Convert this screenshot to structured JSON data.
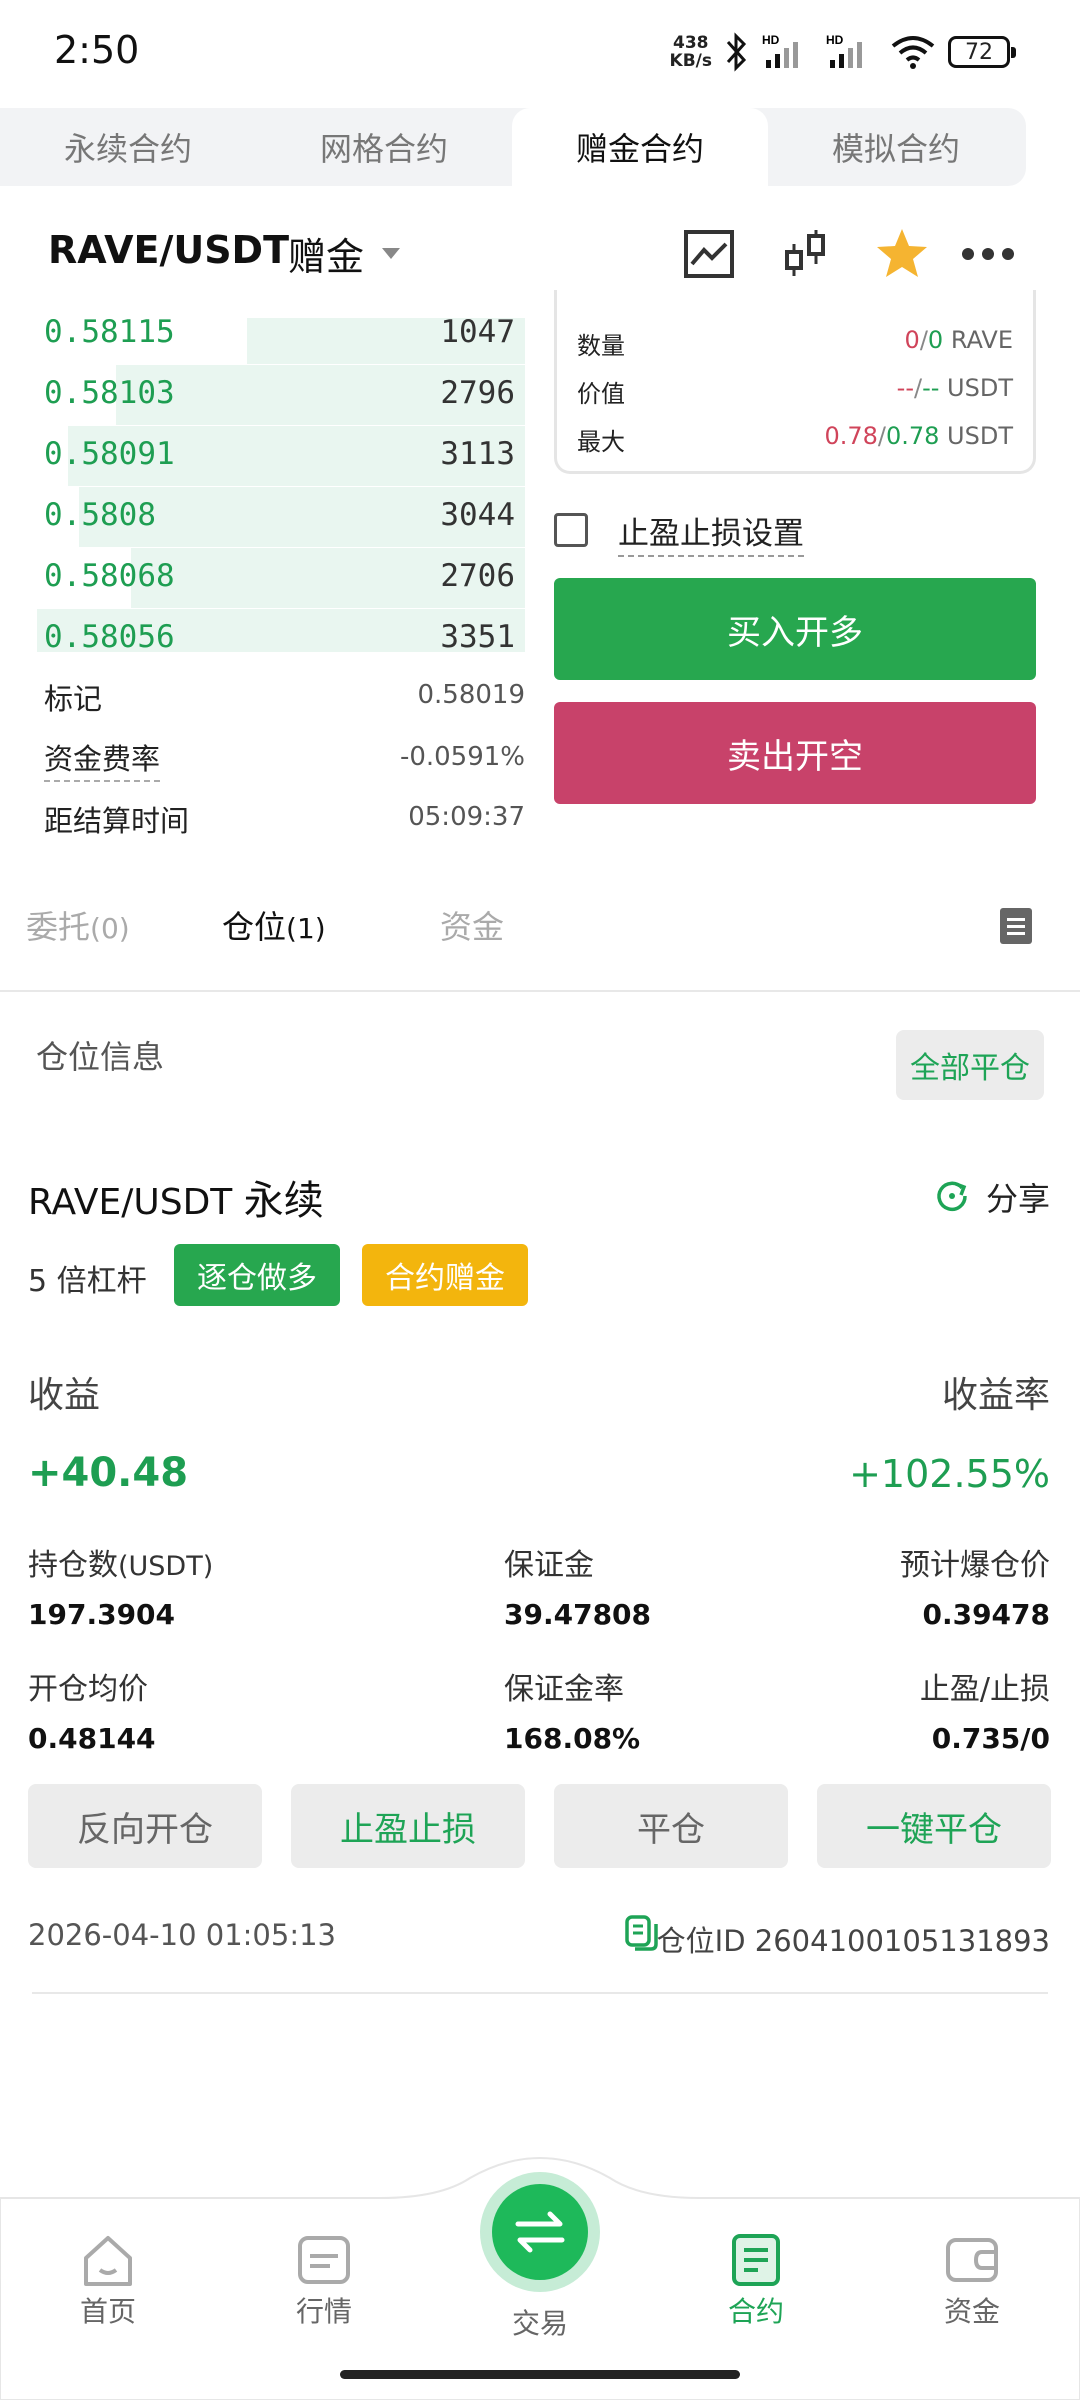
{
  "status_bar": {
    "time": "2:50",
    "net_speed_value": "438",
    "net_speed_unit": "KB/s",
    "battery": "72"
  },
  "tabs": [
    {
      "label": "永续合约",
      "active": false
    },
    {
      "label": "网格合约",
      "active": false
    },
    {
      "label": "赠金合约",
      "active": true
    },
    {
      "label": "模拟合约",
      "active": false
    }
  ],
  "header": {
    "pair": "RAVE/USDT",
    "type": "赠金"
  },
  "order_book": [
    {
      "price": "0.58115",
      "qty": "1047",
      "depth": 0.53
    },
    {
      "price": "0.58103",
      "qty": "2796",
      "depth": 0.78
    },
    {
      "price": "0.58091",
      "qty": "3113",
      "depth": 0.87
    },
    {
      "price": "0.5808",
      "qty": "3044",
      "depth": 0.85
    },
    {
      "price": "0.58068",
      "qty": "2706",
      "depth": 0.75
    },
    {
      "price": "0.58056",
      "qty": "3351",
      "depth": 0.93
    }
  ],
  "market_info": {
    "mark_label": "标记",
    "mark_value": "0.58019",
    "funding_label": "资金费率",
    "funding_value": "-0.0591%",
    "settle_label": "距结算时间",
    "settle_value": "05:09:37"
  },
  "order_card": {
    "qty_label": "数量",
    "qty_a": "0",
    "qty_b": "0",
    "qty_unit": "RAVE",
    "value_label": "价值",
    "value_a": "--",
    "value_b": "--",
    "value_unit": "USDT",
    "max_label": "最大",
    "max_a": "0.78",
    "max_b": "0.78",
    "max_unit": "USDT",
    "sep": "/"
  },
  "tpsl_checkbox_label": "止盈止损设置",
  "buy_label": "买入开多",
  "sell_label": "卖出开空",
  "list_tabs": {
    "orders": "委托",
    "orders_count": "(0)",
    "positions": "仓位",
    "positions_count": "(1)",
    "assets": "资金"
  },
  "position_section": {
    "title": "仓位信息",
    "close_all": "全部平仓"
  },
  "position": {
    "pair": "RAVE/USDT",
    "contract_type": "永续",
    "share": "分享",
    "leverage": "5 倍杠杆",
    "badge_mode": "逐仓做多",
    "badge_bonus": "合约赠金",
    "pnl_label": "收益",
    "pnl_value": "+40.48",
    "roe_label": "收益率",
    "roe_value": "+102.55%",
    "size_label": "持仓数",
    "size_unit": "(USDT)",
    "size_value": "197.3904",
    "margin_label": "保证金",
    "margin_value": "39.47808",
    "liq_label": "预计爆仓价",
    "liq_value": "0.39478",
    "entry_label": "开仓均价",
    "entry_value": "0.48144",
    "margin_rate_label": "保证金率",
    "margin_rate_value": "168.08%",
    "tpsl_label": "止盈/止损",
    "tpsl_value": "0.735/0",
    "actions": [
      "反向开仓",
      "止盈止损",
      "平仓",
      "一键平仓"
    ],
    "time": "2026-04-10 01:05:13",
    "id_label": "仓位ID",
    "id_value": "2604100105131893"
  },
  "bottom_nav": [
    {
      "label": "首页",
      "icon": "home-icon"
    },
    {
      "label": "行情",
      "icon": "market-icon"
    },
    {
      "label": "交易",
      "icon": "swap-icon"
    },
    {
      "label": "合约",
      "icon": "contract-icon",
      "active": true
    },
    {
      "label": "资金",
      "icon": "wallet-icon"
    }
  ],
  "colors": {
    "green": "#1e9e52",
    "buy": "#27a74f",
    "sell": "#c8426a",
    "bonus": "#f3b50d",
    "red": "#d0445a",
    "accent_green": "#1ea456"
  }
}
